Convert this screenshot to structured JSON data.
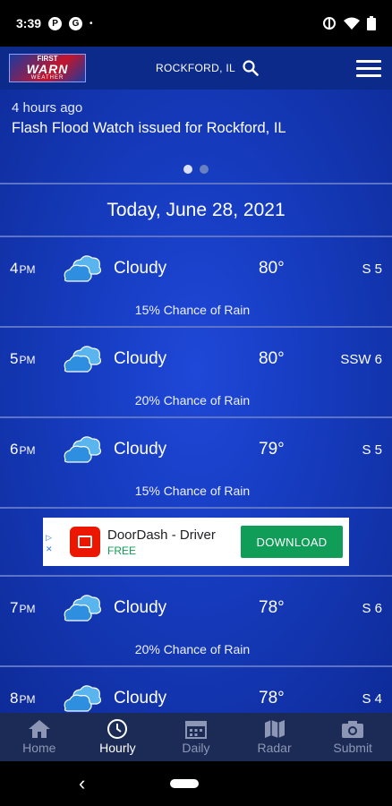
{
  "status": {
    "time": "3:39",
    "app_icons": [
      "P",
      "G"
    ],
    "dot": "•"
  },
  "header": {
    "logo_top": "FIRST",
    "logo_mid": "WARN",
    "logo_bot": "WEATHER",
    "location": "ROCKFORD, IL",
    "search_icon": "search-icon",
    "menu_icon": "menu-icon"
  },
  "alert": {
    "time_ago": "4 hours ago",
    "title": "Flash Flood Watch issued for Rockford, IL",
    "page_count": 2,
    "active_page": 1
  },
  "forecast": {
    "date": "Today, June 28, 2021",
    "hours": [
      {
        "hour": "4",
        "ampm": "PM",
        "condition": "Cloudy",
        "temp": "80°",
        "wind": "S 5",
        "rain": "15% Chance of Rain",
        "icon": "cloud-icon"
      },
      {
        "hour": "5",
        "ampm": "PM",
        "condition": "Cloudy",
        "temp": "80°",
        "wind": "SSW 6",
        "rain": "20% Chance of Rain",
        "icon": "cloud-icon"
      },
      {
        "hour": "6",
        "ampm": "PM",
        "condition": "Cloudy",
        "temp": "79°",
        "wind": "S 5",
        "rain": "15% Chance of Rain",
        "icon": "cloud-icon"
      },
      {
        "hour": "7",
        "ampm": "PM",
        "condition": "Cloudy",
        "temp": "78°",
        "wind": "S 6",
        "rain": "20% Chance of Rain",
        "icon": "cloud-icon"
      },
      {
        "hour": "8",
        "ampm": "PM",
        "condition": "Cloudy",
        "temp": "78°",
        "wind": "S 4",
        "rain": "",
        "icon": "cloud-icon"
      }
    ]
  },
  "ad": {
    "title": "DoorDash - Driver",
    "subtitle": "FREE",
    "cta": "DOWNLOAD",
    "brand_color": "#eb1700",
    "cta_color": "#0f9d58"
  },
  "nav": {
    "tabs": [
      {
        "label": "Home",
        "icon": "home-icon",
        "active": false
      },
      {
        "label": "Hourly",
        "icon": "clock-icon",
        "active": true
      },
      {
        "label": "Daily",
        "icon": "calendar-icon",
        "active": false
      },
      {
        "label": "Radar",
        "icon": "map-icon",
        "active": false
      },
      {
        "label": "Submit",
        "icon": "camera-icon",
        "active": false
      }
    ]
  },
  "colors": {
    "header_bg": "#0b2a8a",
    "content_bg": "#163cc0",
    "nav_bg": "#1b2b55",
    "divider": "#5d73c8"
  }
}
